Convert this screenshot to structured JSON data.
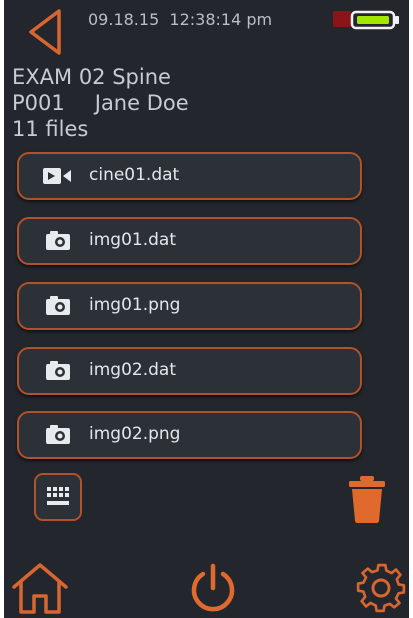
{
  "status_bar": {
    "date": "09.18.15",
    "time": "12:38:14 pm",
    "recording_indicator_color": "#8a1416",
    "battery_color": "#a3e600"
  },
  "exam": {
    "title": "EXAM 02 Spine",
    "patient_id": "P001",
    "patient_name": "Jane Doe",
    "file_count": "11 files"
  },
  "files": [
    {
      "name": "cine01.dat",
      "icon": "video-camera-icon"
    },
    {
      "name": "img01.dat",
      "icon": "camera-icon"
    },
    {
      "name": "img01.png",
      "icon": "camera-icon"
    },
    {
      "name": "img02.dat",
      "icon": "camera-icon"
    },
    {
      "name": "img02.png",
      "icon": "camera-icon"
    }
  ],
  "toolbar": {
    "keyboard_icon": "keyboard-icon",
    "delete_icon": "trash-icon"
  },
  "bottom_nav": {
    "home_icon": "home-icon",
    "power_icon": "power-icon",
    "settings_icon": "gear-icon"
  },
  "colors": {
    "background": "#23272d",
    "accent": "#e0692e",
    "item_border": "#b0522a",
    "text": "#c7ccd2"
  }
}
